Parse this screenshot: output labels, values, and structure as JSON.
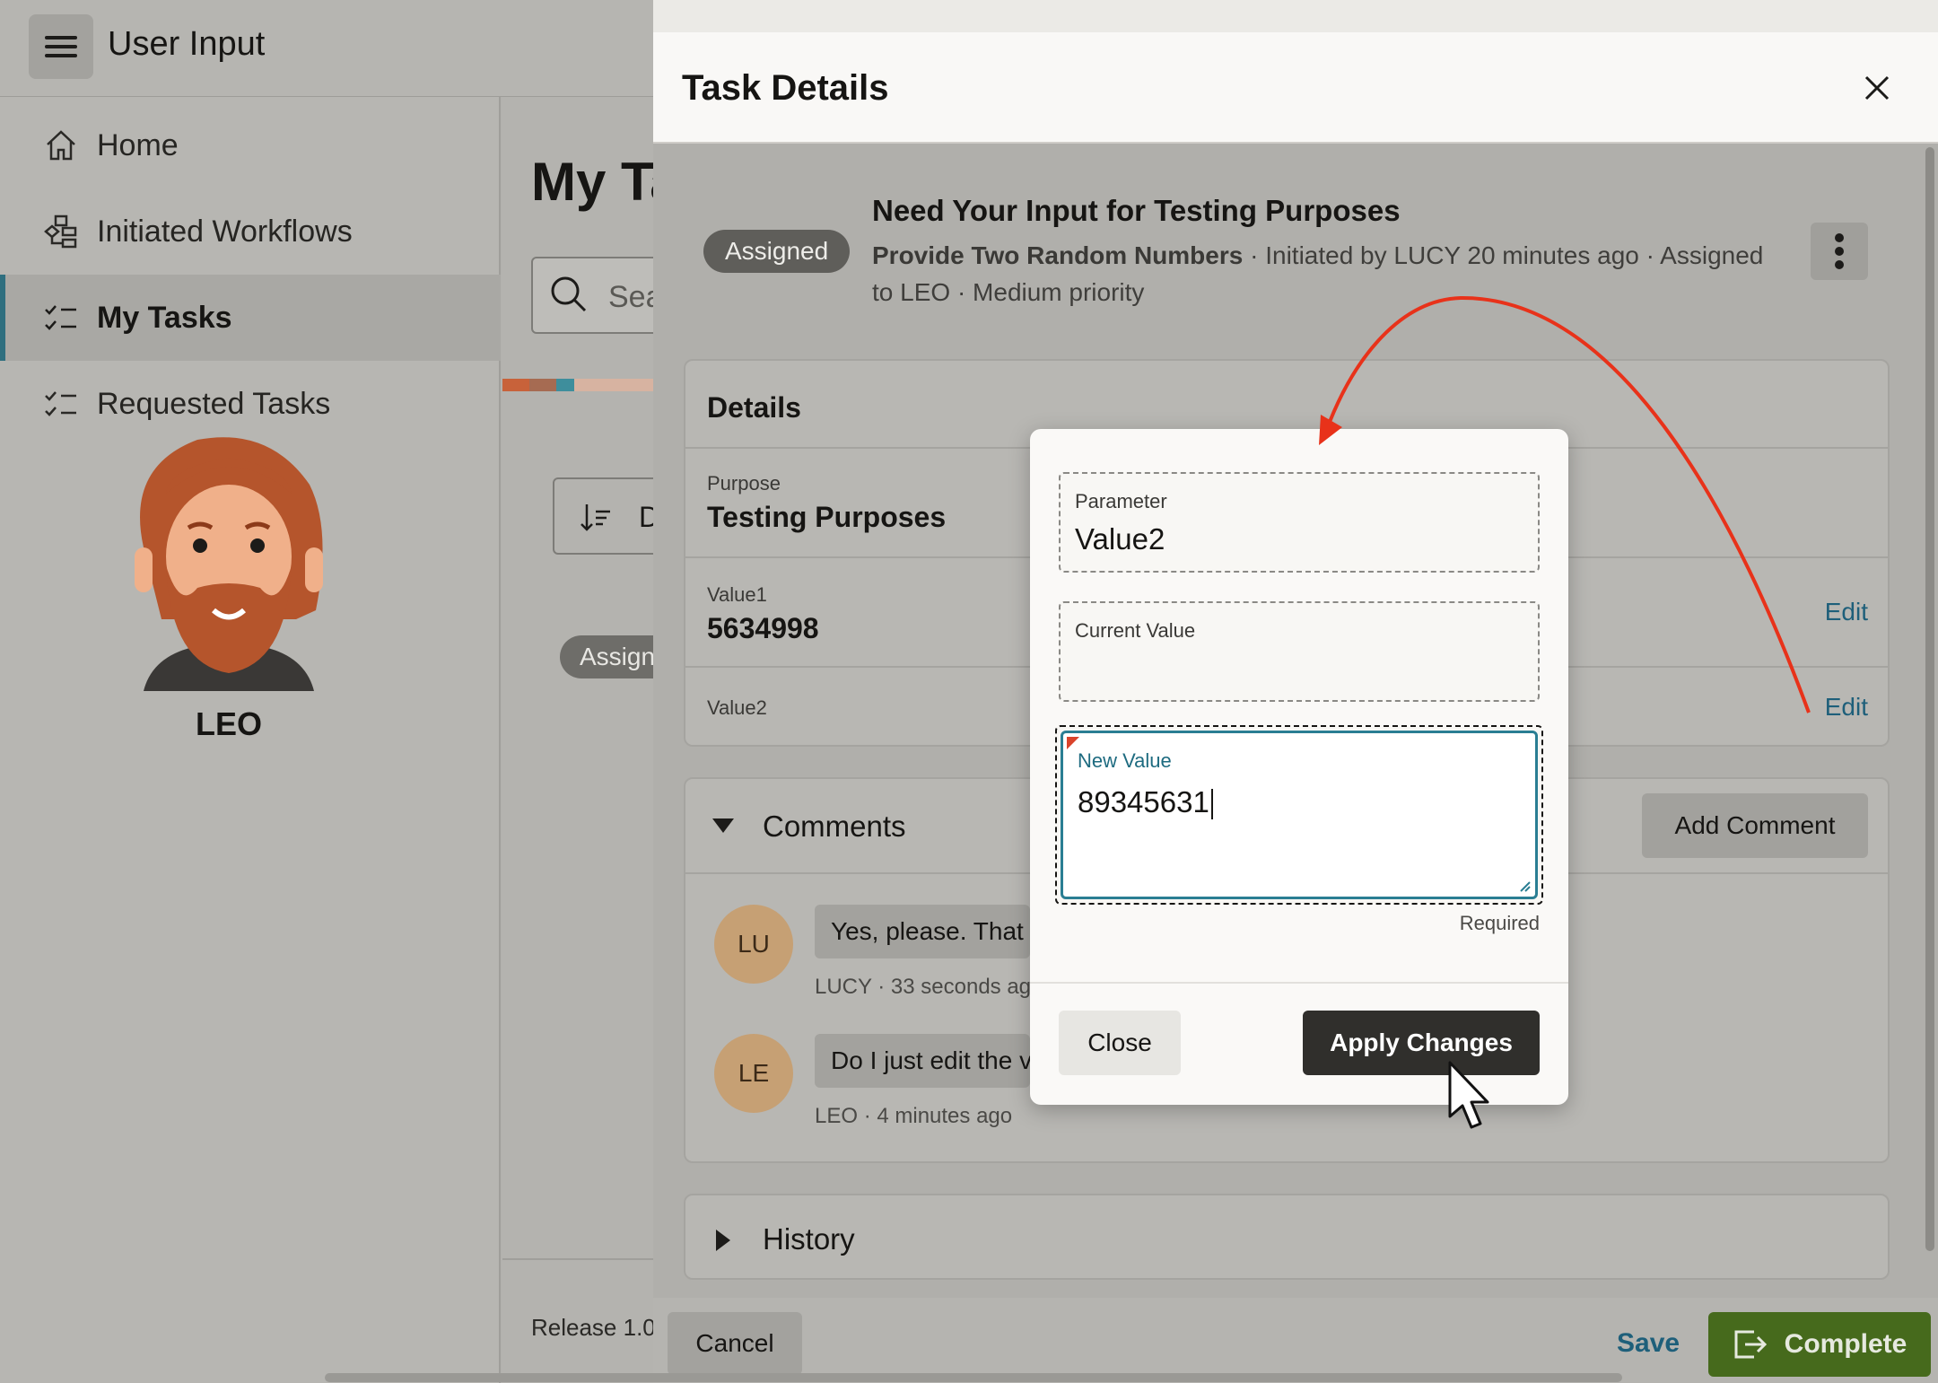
{
  "app": {
    "title": "User Input"
  },
  "sidebar": {
    "items": [
      {
        "label": "Home",
        "icon": "home-icon"
      },
      {
        "label": "Initiated Workflows",
        "icon": "workflow-icon"
      },
      {
        "label": "My Tasks",
        "icon": "task-list-icon",
        "active": true
      },
      {
        "label": "Requested Tasks",
        "icon": "task-list-icon"
      }
    ],
    "user_name": "LEO"
  },
  "main": {
    "title": "My Ta",
    "search_placeholder": "Sea",
    "sort_label": "D",
    "chip": "Assign",
    "release": "Release 1.0"
  },
  "drawer": {
    "title": "Task Details",
    "status": "Assigned",
    "task_title": "Need Your Input for Testing Purposes",
    "task_subtitle": "Provide Two Random Numbers",
    "task_meta_1": " · Initiated by LUCY 20 minutes ago · Assigned",
    "task_meta_2": "to LEO · Medium priority",
    "details": {
      "title": "Details",
      "purpose_label": "Purpose",
      "purpose_value": "Testing Purposes",
      "value1_label": "Value1",
      "value1_value": "5634998",
      "value2_label": "Value2",
      "edit_label": "Edit"
    },
    "comments": {
      "title": "Comments",
      "add_label": "Add Comment",
      "items": [
        {
          "initials": "LU",
          "text": "Yes, please. That w",
          "meta": "LUCY · 33 seconds ago"
        },
        {
          "initials": "LE",
          "text": "Do I just edit the va",
          "meta": "LEO · 4 minutes ago"
        }
      ]
    },
    "history": {
      "title": "History"
    },
    "footer": {
      "cancel": "Cancel",
      "save": "Save",
      "complete": "Complete"
    }
  },
  "modal": {
    "parameter_label": "Parameter",
    "parameter_value": "Value2",
    "current_label": "Current Value",
    "current_value": "",
    "new_label": "New Value",
    "new_value": "89345631",
    "required_hint": "Required",
    "close_label": "Close",
    "apply_label": "Apply Changes"
  },
  "colors": {
    "annotation_arrow": "#e8321a",
    "complete": "#466a1c",
    "link": "#1e5f7a",
    "focus": "#2a7e93"
  }
}
